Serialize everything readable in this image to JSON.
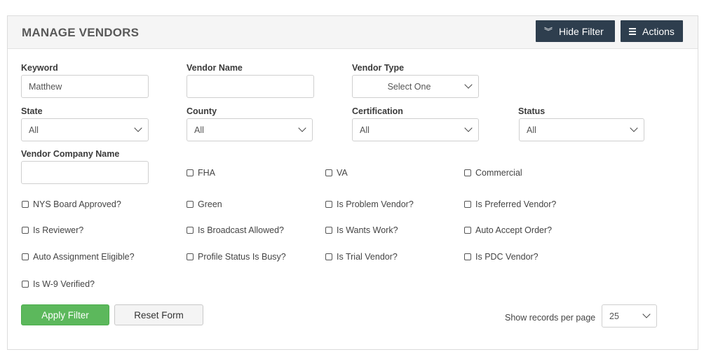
{
  "header": {
    "title": "MANAGE VENDORS",
    "hide_filter_label": "Hide Filter",
    "actions_label": "Actions"
  },
  "filters": {
    "keyword": {
      "label": "Keyword",
      "value": "Matthew"
    },
    "vendor_name": {
      "label": "Vendor Name",
      "value": ""
    },
    "vendor_type": {
      "label": "Vendor Type",
      "value": "Select One"
    },
    "state": {
      "label": "State",
      "value": "All"
    },
    "county": {
      "label": "County",
      "value": "All"
    },
    "certification": {
      "label": "Certification",
      "value": "All"
    },
    "status": {
      "label": "Status",
      "value": "All"
    },
    "vendor_company_name": {
      "label": "Vendor Company Name",
      "value": ""
    }
  },
  "checkboxes": [
    {
      "label": "FHA",
      "checked": false
    },
    {
      "label": "VA",
      "checked": false
    },
    {
      "label": "Commercial",
      "checked": false
    },
    {
      "label": "NYS Board Approved?",
      "checked": false
    },
    {
      "label": "Green",
      "checked": false
    },
    {
      "label": "Is Problem Vendor?",
      "checked": false
    },
    {
      "label": "Is Preferred Vendor?",
      "checked": false
    },
    {
      "label": "Is Reviewer?",
      "checked": false
    },
    {
      "label": "Is Broadcast Allowed?",
      "checked": false
    },
    {
      "label": "Is Wants Work?",
      "checked": false
    },
    {
      "label": "Auto Accept Order?",
      "checked": false
    },
    {
      "label": "Auto Assignment Eligible?",
      "checked": false
    },
    {
      "label": "Profile Status Is Busy?",
      "checked": false
    },
    {
      "label": "Is Trial Vendor?",
      "checked": false
    },
    {
      "label": "Is PDC Vendor?",
      "checked": false
    },
    {
      "label": "Is W-9 Verified?",
      "checked": false
    }
  ],
  "footer": {
    "apply_label": "Apply Filter",
    "reset_label": "Reset Form",
    "per_page_label": "Show records per page",
    "per_page_value": "25"
  },
  "colors": {
    "header_button": "#2e3e4e",
    "apply_button": "#5cb85c"
  }
}
